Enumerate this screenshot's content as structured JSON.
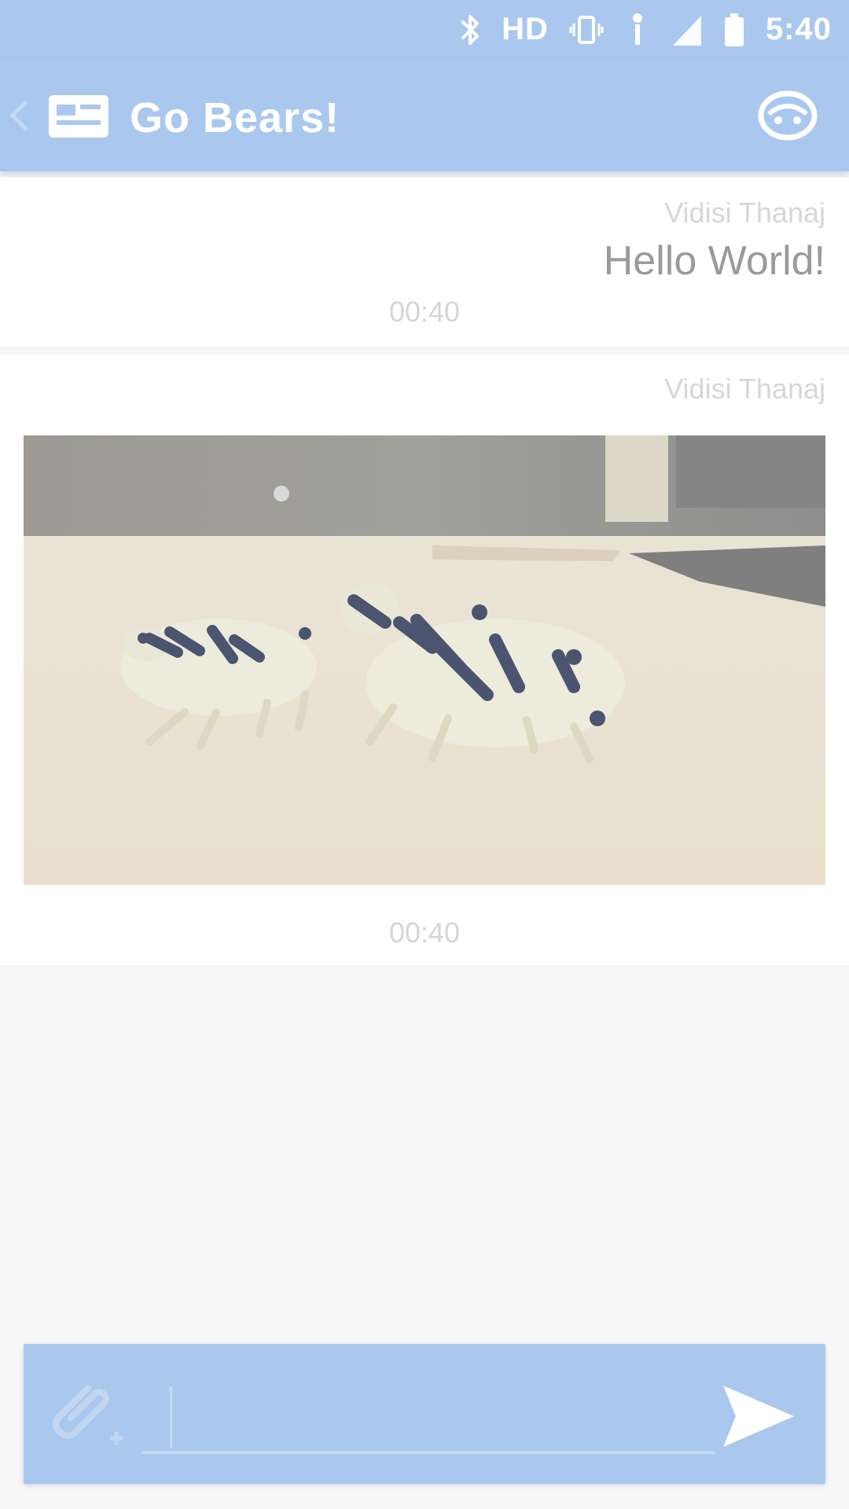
{
  "status_bar": {
    "time": "5:40",
    "icons": [
      "bluetooth-icon",
      "hd-icon",
      "vibrate-icon",
      "wifi-icon",
      "signal-icon",
      "battery-icon"
    ],
    "hd_label": "HD"
  },
  "app_bar": {
    "title": "Go Bears!",
    "icons": [
      "back-arrow-icon",
      "app-logo-icon",
      "group-chat-icon"
    ]
  },
  "messages": [
    {
      "sender": "Vidisi Thanaj",
      "text": "Hello World!",
      "time": "00:40"
    },
    {
      "sender": "Vidisi Thanaj",
      "attachment": "photo",
      "attachment_description": "two black and white toy animals on a floor",
      "time": "00:40"
    }
  ],
  "compose": {
    "input_value": "",
    "placeholder": "",
    "attach_icon": "paperclip-icon",
    "send_icon": "send-icon"
  },
  "colors": {
    "primary": "#aac8ee",
    "background": "#f7f7f7",
    "message_background": "#ffffff",
    "muted_text": "#d5d5d5"
  }
}
